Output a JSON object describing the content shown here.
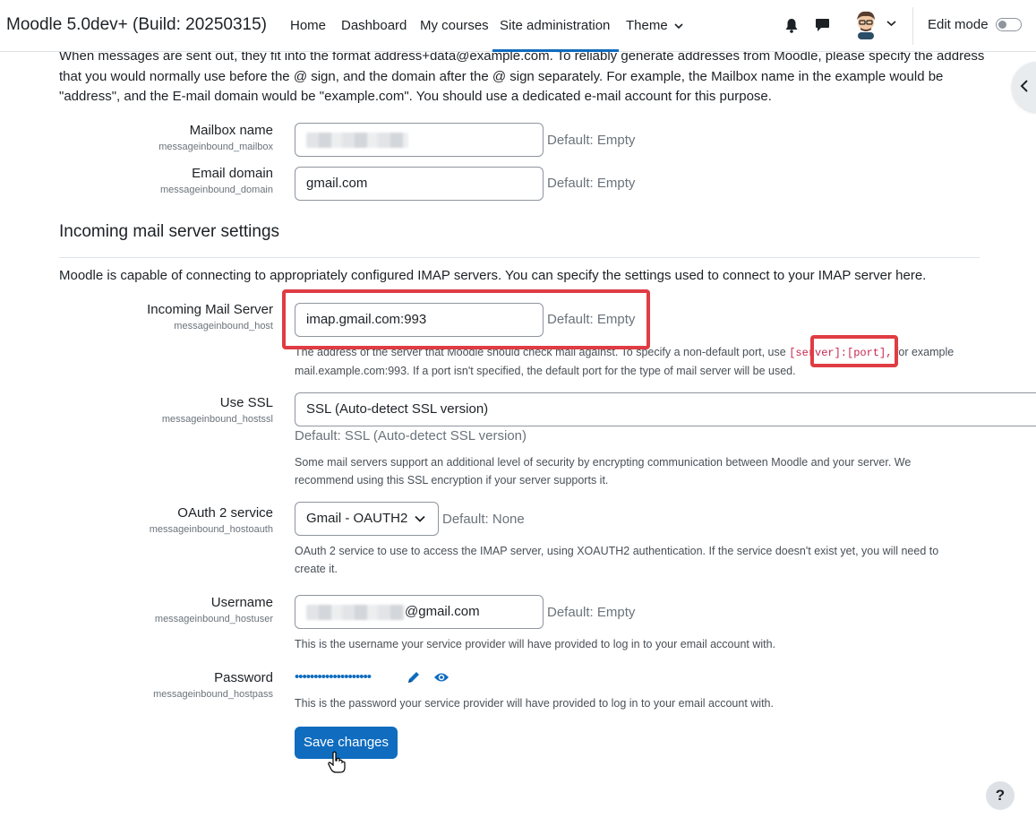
{
  "navbar": {
    "brand": "Moodle 5.0dev+ (Build: 20250315)",
    "links": [
      "Home",
      "Dashboard",
      "My courses",
      "Site administration",
      "Theme"
    ],
    "active": "Site administration",
    "edit_mode_label": "Edit mode",
    "icons": [
      "bell-icon",
      "chat-icon",
      "user-avatar",
      "chevron-down-icon"
    ]
  },
  "intro": {
    "text": "When messages are sent out, they fit into the format address+data@example.com. To reliably generate addresses from Moodle, please specify the address that you would normally use before the @ sign, and the domain after the @ sign separately. For example, the Mailbox name in the example would be \"address\", and the E-mail domain would be \"example.com\". You should use a dedicated e-mail account for this purpose."
  },
  "settings": {
    "mailbox": {
      "label": "Mailbox name",
      "key": "messageinbound_mailbox",
      "value": "",
      "default": "Default: Empty"
    },
    "domain": {
      "label": "Email domain",
      "key": "messageinbound_domain",
      "value": "gmail.com",
      "default": "Default: Empty"
    }
  },
  "section": {
    "heading": "Incoming mail server settings",
    "description": "Moodle is capable of connecting to appropriately configured IMAP servers. You can specify the settings used to connect to your IMAP server here."
  },
  "server": {
    "host": {
      "label": "Incoming Mail Server",
      "key": "messageinbound_host",
      "value": "imap.gmail.com:993",
      "default": "Default: Empty",
      "desc_before": "The address of the server that Moodle should check mail against. To specify a non-default port, use",
      "desc_code": "[server]:[port],",
      "desc_after": "for example",
      "desc_line2": "mail.example.com:993. If a port isn't specified, the default port for the type of mail server will be used."
    },
    "ssl": {
      "label": "Use SSL",
      "key": "messageinbound_hostssl",
      "value": "SSL (Auto-detect SSL version)",
      "default": "Default: SSL (Auto-detect SSL version)",
      "desc_line1": "Some mail servers support an additional level of security by encrypting communication between Moodle and your server. We",
      "desc_line2": "recommend using this SSL encryption if your server supports it."
    },
    "oauth": {
      "label": "OAuth 2 service",
      "key": "messageinbound_hostoauth",
      "value": "Gmail - OAUTH2",
      "default": "Default: None",
      "desc_line1": "OAuth 2 service to use to access the IMAP server, using XOAUTH2 authentication. If the service doesn't exist yet, you will need to",
      "desc_line2": "create it."
    },
    "username": {
      "label": "Username",
      "key": "messageinbound_hostuser",
      "value_suffix": "@gmail.com",
      "default": "Default: Empty",
      "desc": "This is the username your service provider will have provided to log in to your email account with."
    },
    "password": {
      "label": "Password",
      "key": "messageinbound_hostpass",
      "masked": "••••••••••••••••••••",
      "desc": "This is the password your service provider will have provided to log in to your email account with."
    }
  },
  "actions": {
    "save": "Save changes",
    "help": "?"
  },
  "colors": {
    "accent": "#0f6cbf",
    "highlight": "#e03c43"
  }
}
